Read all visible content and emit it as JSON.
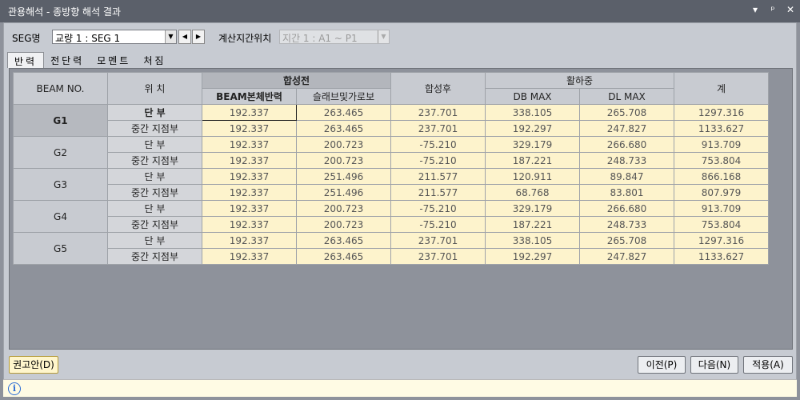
{
  "window": {
    "title": "관용해석 - 종방향 해석 결과",
    "controls": [
      "▾",
      "ᵖ",
      "✕"
    ]
  },
  "toolbar": {
    "seg_label": "SEG명",
    "seg_value": "교량 1 : SEG 1",
    "span_label": "계산지간위치",
    "span_value": "지간 1 : A1 ~ P1"
  },
  "tabs": [
    "반력",
    "전단력",
    "모멘트",
    "처짐"
  ],
  "table": {
    "headers": {
      "beam_no": "BEAM NO.",
      "position": "위 치",
      "before_composite": "합성전",
      "beam_self": "BEAM본체반력",
      "slab": "슬래브및가로보",
      "after_composite": "합성후",
      "live_load": "활하중",
      "db_max": "DB MAX",
      "dl_max": "DL MAX",
      "total": "계"
    },
    "rows": [
      {
        "beam": "G1",
        "pos": "단 부",
        "v": [
          "192.337",
          "263.465",
          "237.701",
          "338.105",
          "265.708",
          "1297.316"
        ]
      },
      {
        "beam": "",
        "pos": "중간 지점부",
        "v": [
          "192.337",
          "263.465",
          "237.701",
          "192.297",
          "247.827",
          "1133.627"
        ]
      },
      {
        "beam": "G2",
        "pos": "단 부",
        "v": [
          "192.337",
          "200.723",
          "-75.210",
          "329.179",
          "266.680",
          "913.709"
        ]
      },
      {
        "beam": "",
        "pos": "중간 지점부",
        "v": [
          "192.337",
          "200.723",
          "-75.210",
          "187.221",
          "248.733",
          "753.804"
        ]
      },
      {
        "beam": "G3",
        "pos": "단 부",
        "v": [
          "192.337",
          "251.496",
          "211.577",
          "120.911",
          "89.847",
          "866.168"
        ]
      },
      {
        "beam": "",
        "pos": "중간 지점부",
        "v": [
          "192.337",
          "251.496",
          "211.577",
          "68.768",
          "83.801",
          "807.979"
        ]
      },
      {
        "beam": "G4",
        "pos": "단 부",
        "v": [
          "192.337",
          "200.723",
          "-75.210",
          "329.179",
          "266.680",
          "913.709"
        ]
      },
      {
        "beam": "",
        "pos": "중간 지점부",
        "v": [
          "192.337",
          "200.723",
          "-75.210",
          "187.221",
          "248.733",
          "753.804"
        ]
      },
      {
        "beam": "G5",
        "pos": "단 부",
        "v": [
          "192.337",
          "263.465",
          "237.701",
          "338.105",
          "265.708",
          "1297.316"
        ]
      },
      {
        "beam": "",
        "pos": "중간 지점부",
        "v": [
          "192.337",
          "263.465",
          "237.701",
          "192.297",
          "247.827",
          "1133.627"
        ]
      }
    ]
  },
  "buttons": {
    "recommend": "권고안(D)",
    "prev": "이전(P)",
    "next": "다음(N)",
    "apply": "적용(A)"
  },
  "status": {
    "icon": "info-icon",
    "text": ""
  },
  "colors": {
    "cell_bg": "#fdf3cc",
    "titlebar": "#5b606a",
    "panel": "#8e929b"
  }
}
